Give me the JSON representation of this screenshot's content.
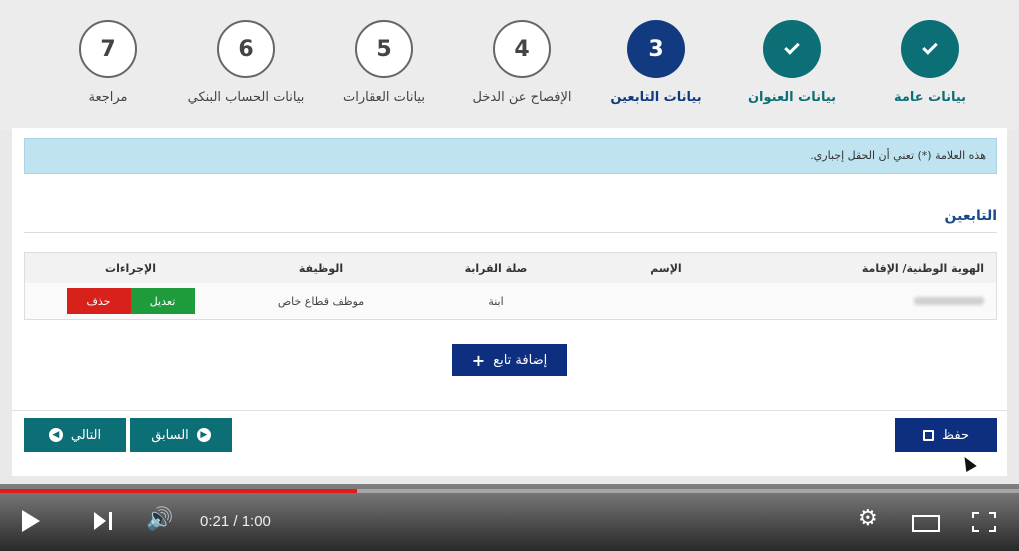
{
  "stepper": {
    "steps": [
      {
        "number": "7",
        "label": "مراجعة",
        "state": "todo"
      },
      {
        "number": "6",
        "label": "بيانات الحساب البنكي",
        "state": "todo"
      },
      {
        "number": "5",
        "label": "بيانات العقارات",
        "state": "todo"
      },
      {
        "number": "4",
        "label": "الإفصاح عن الدخل",
        "state": "todo"
      },
      {
        "number": "3",
        "label": "بيانات التابعين",
        "state": "active"
      },
      {
        "number": "",
        "label": "بيانات العنوان",
        "state": "done"
      },
      {
        "number": "",
        "label": "بيانات عامة",
        "state": "done"
      }
    ]
  },
  "info_bar": {
    "text": "هذه العلامة (*) تعني أن الحقل إجباري."
  },
  "section": {
    "title": "التابعين"
  },
  "table": {
    "headers": {
      "id": "الهوية الوطنية/ الإقامة",
      "name": "الإسم",
      "relation": "صلة القرابة",
      "job": "الوظيفة",
      "actions": "الإجراءات"
    },
    "rows": [
      {
        "name": "",
        "relation": "ابنة",
        "job": "موظف قطاع خاص",
        "edit_label": "تعديل",
        "delete_label": "حذف"
      }
    ]
  },
  "buttons": {
    "add_dependent": "إضافة تابع",
    "previous": "السابق",
    "next": "التالي",
    "save": "حفظ"
  },
  "player": {
    "time": "0:21 / 1:00",
    "progress": 0.35,
    "progress_color": "#e51a1a"
  },
  "colors": {
    "done": "#0d6f76",
    "active": "#123a80",
    "edit": "#1e9b3a",
    "delete": "#d8211a",
    "primary": "#0e2f80"
  }
}
